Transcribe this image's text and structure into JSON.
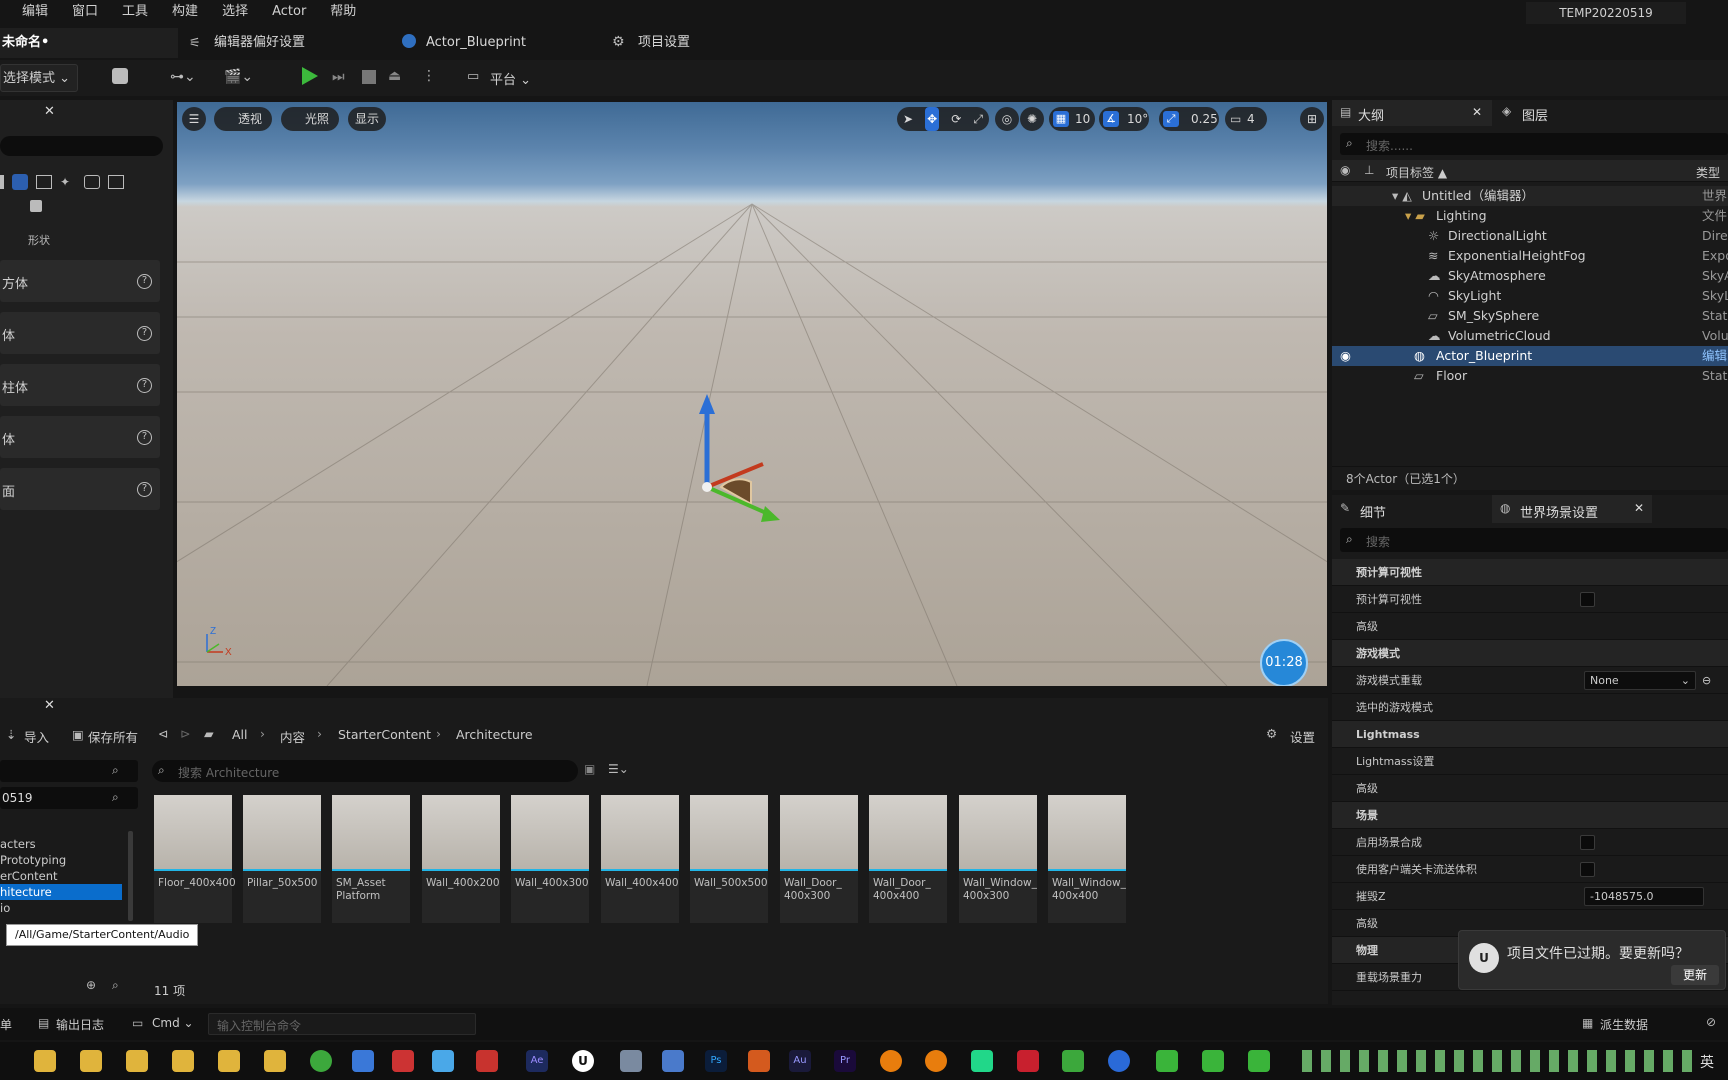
{
  "menu": [
    "编辑",
    "窗口",
    "工具",
    "构建",
    "选择",
    "Actor",
    "帮助"
  ],
  "project_name": "TEMP20220519",
  "tabs": {
    "level": "未命名•",
    "prefs": "编辑器偏好设置",
    "blueprint": "Actor_Blueprint",
    "settings": "项目设置"
  },
  "toolbar": {
    "mode": "选择模式",
    "platform": "平台"
  },
  "left": {
    "shapes_label": "形状",
    "rows": [
      "方体",
      "体",
      "柱体",
      "体",
      "面"
    ]
  },
  "viewport": {
    "perspective": "透视",
    "lighting": "光照",
    "show": "显示",
    "grid": "10",
    "angle": "10°",
    "scale": "0.25",
    "camera_speed": "4",
    "timer": "01:28"
  },
  "outliner": {
    "tab": "大纲",
    "layers_tab": "图层",
    "search_placeholder": "搜索......",
    "col_label": "项目标签 ▲",
    "col_type": "类型",
    "rows": [
      {
        "name": "Untitled（编辑器）",
        "type": "世界"
      },
      {
        "name": "Lighting",
        "type": "文件"
      },
      {
        "name": "DirectionalLight",
        "type": "Direc"
      },
      {
        "name": "ExponentialHeightFog",
        "type": "Expo"
      },
      {
        "name": "SkyAtmosphere",
        "type": "SkyA"
      },
      {
        "name": "SkyLight",
        "type": "SkyL"
      },
      {
        "name": "SM_SkySphere",
        "type": "Stati"
      },
      {
        "name": "VolumetricCloud",
        "type": "Volu"
      },
      {
        "name": "Actor_Blueprint",
        "type": "编辑"
      },
      {
        "name": "Floor",
        "type": "Stati"
      }
    ],
    "count": "8个Actor（已选1个）"
  },
  "details": {
    "tab": "细节",
    "world_tab": "世界场景设置",
    "search_placeholder": "搜索",
    "rows": [
      {
        "label": "预计算可视性",
        "cat": true
      },
      {
        "label": "预计算可视性",
        "check": true
      },
      {
        "label": "高级",
        "sub": true
      },
      {
        "label": "游戏模式",
        "cat": true
      },
      {
        "label": "游戏模式重载",
        "value": "None"
      },
      {
        "label": "选中的游戏模式",
        "sub": true
      },
      {
        "label": "Lightmass",
        "cat": true
      },
      {
        "label": "Lightmass设置",
        "sub": true
      },
      {
        "label": "高级",
        "sub": true
      },
      {
        "label": "场景",
        "cat": true
      },
      {
        "label": "启用场景合成",
        "check": true
      },
      {
        "label": "使用客户端关卡流送体积",
        "check": true
      },
      {
        "label": "摧毁Z",
        "value": "-1048575.0"
      },
      {
        "label": "高级",
        "sub": true
      },
      {
        "label": "物理",
        "cat": true
      },
      {
        "label": "重载场景重力"
      }
    ]
  },
  "content": {
    "import": "导入",
    "save_all": "保存所有",
    "crumbs": [
      "All",
      "内容",
      "StarterContent",
      "Architecture"
    ],
    "settings": "设置",
    "search_placeholder": "搜索 Architecture",
    "folder_search": "0519",
    "folders": [
      "acters",
      "Prototyping",
      "erContent",
      "hitecture",
      "io"
    ],
    "tooltip": "/All/Game/StarterContent/Audio",
    "items": [
      "Floor_400x400",
      "Pillar_50x500",
      "SM_Asset Platform",
      "Wall_400x200",
      "Wall_400x300",
      "Wall_400x400",
      "Wall_500x500",
      "Wall_Door_ 400x300",
      "Wall_Door_ 400x400",
      "Wall_Window_ 400x300",
      "Wall_Window_ 400x400"
    ],
    "count": "11 项"
  },
  "status": {
    "drawer": "单",
    "output": "输出日志",
    "cmd": "Cmd",
    "cmd_placeholder": "输入控制台命令",
    "derived": "派生数据"
  },
  "toast": {
    "message": "项目文件已过期。要更新吗？",
    "button": "更新"
  },
  "taskbar": {
    "lang": "英"
  }
}
